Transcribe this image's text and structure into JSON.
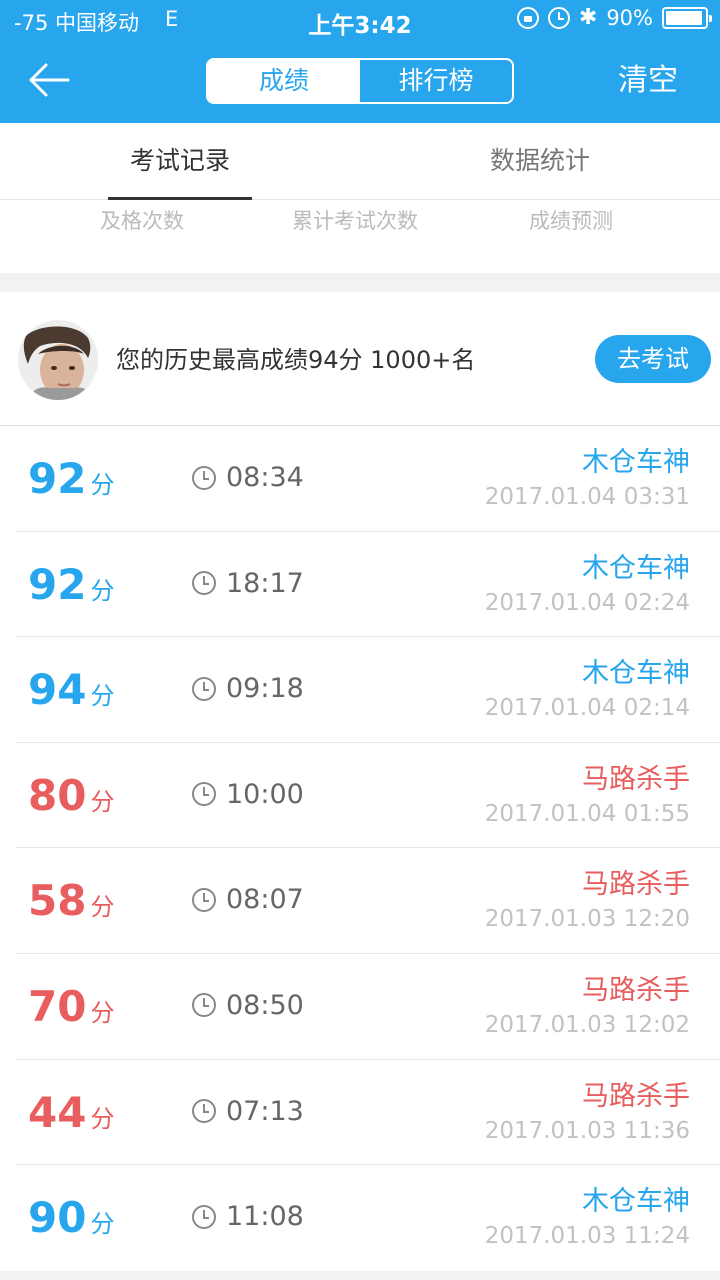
{
  "status_bar": {
    "carrier": "-75 中国移动",
    "network": "E",
    "time": "上午3:42",
    "battery": "90%"
  },
  "header": {
    "segments": [
      "成绩",
      "排行榜"
    ],
    "clear_label": "清空"
  },
  "tabs": [
    "考试记录",
    "数据统计"
  ],
  "stats_labels": [
    "及格次数",
    "累计考试次数",
    "成绩预测"
  ],
  "best": {
    "text": "您的历史最高成绩94分 1000+名",
    "button": "去考试"
  },
  "score_unit": "分",
  "colors": {
    "accent": "#27a6ee",
    "fail": "#e85d5d"
  },
  "records": [
    {
      "score": "92",
      "duration": "08:34",
      "title": "木仓车神",
      "date": "2017.01.04 03:31",
      "status": "pass"
    },
    {
      "score": "92",
      "duration": "18:17",
      "title": "木仓车神",
      "date": "2017.01.04 02:24",
      "status": "pass"
    },
    {
      "score": "94",
      "duration": "09:18",
      "title": "木仓车神",
      "date": "2017.01.04 02:14",
      "status": "pass"
    },
    {
      "score": "80",
      "duration": "10:00",
      "title": "马路杀手",
      "date": "2017.01.04 01:55",
      "status": "fail"
    },
    {
      "score": "58",
      "duration": "08:07",
      "title": "马路杀手",
      "date": "2017.01.03 12:20",
      "status": "fail"
    },
    {
      "score": "70",
      "duration": "08:50",
      "title": "马路杀手",
      "date": "2017.01.03 12:02",
      "status": "fail"
    },
    {
      "score": "44",
      "duration": "07:13",
      "title": "马路杀手",
      "date": "2017.01.03 11:36",
      "status": "fail"
    },
    {
      "score": "90",
      "duration": "11:08",
      "title": "木仓车神",
      "date": "2017.01.03 11:24",
      "status": "pass"
    }
  ]
}
